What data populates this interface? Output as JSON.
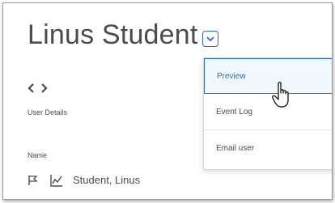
{
  "page": {
    "title": "Linus Student",
    "user_details_label": "User Details",
    "name_header": "Name"
  },
  "row": {
    "student_name": "Student, Linus"
  },
  "menu": {
    "items": [
      {
        "label": "Preview",
        "active": true
      },
      {
        "label": "Event Log",
        "active": false
      },
      {
        "label": "Email user",
        "active": false
      }
    ]
  },
  "icons": {
    "context_menu": "chevron-down-icon",
    "prev": "chevron-left-icon",
    "next": "chevron-right-icon",
    "flag": "flag-icon",
    "progress": "line-chart-icon",
    "cursor": "hand-pointer-icon"
  },
  "colors": {
    "accent": "#2a6ebb",
    "text": "#494c4e",
    "menu_active_bg": "#f1f8fd"
  }
}
